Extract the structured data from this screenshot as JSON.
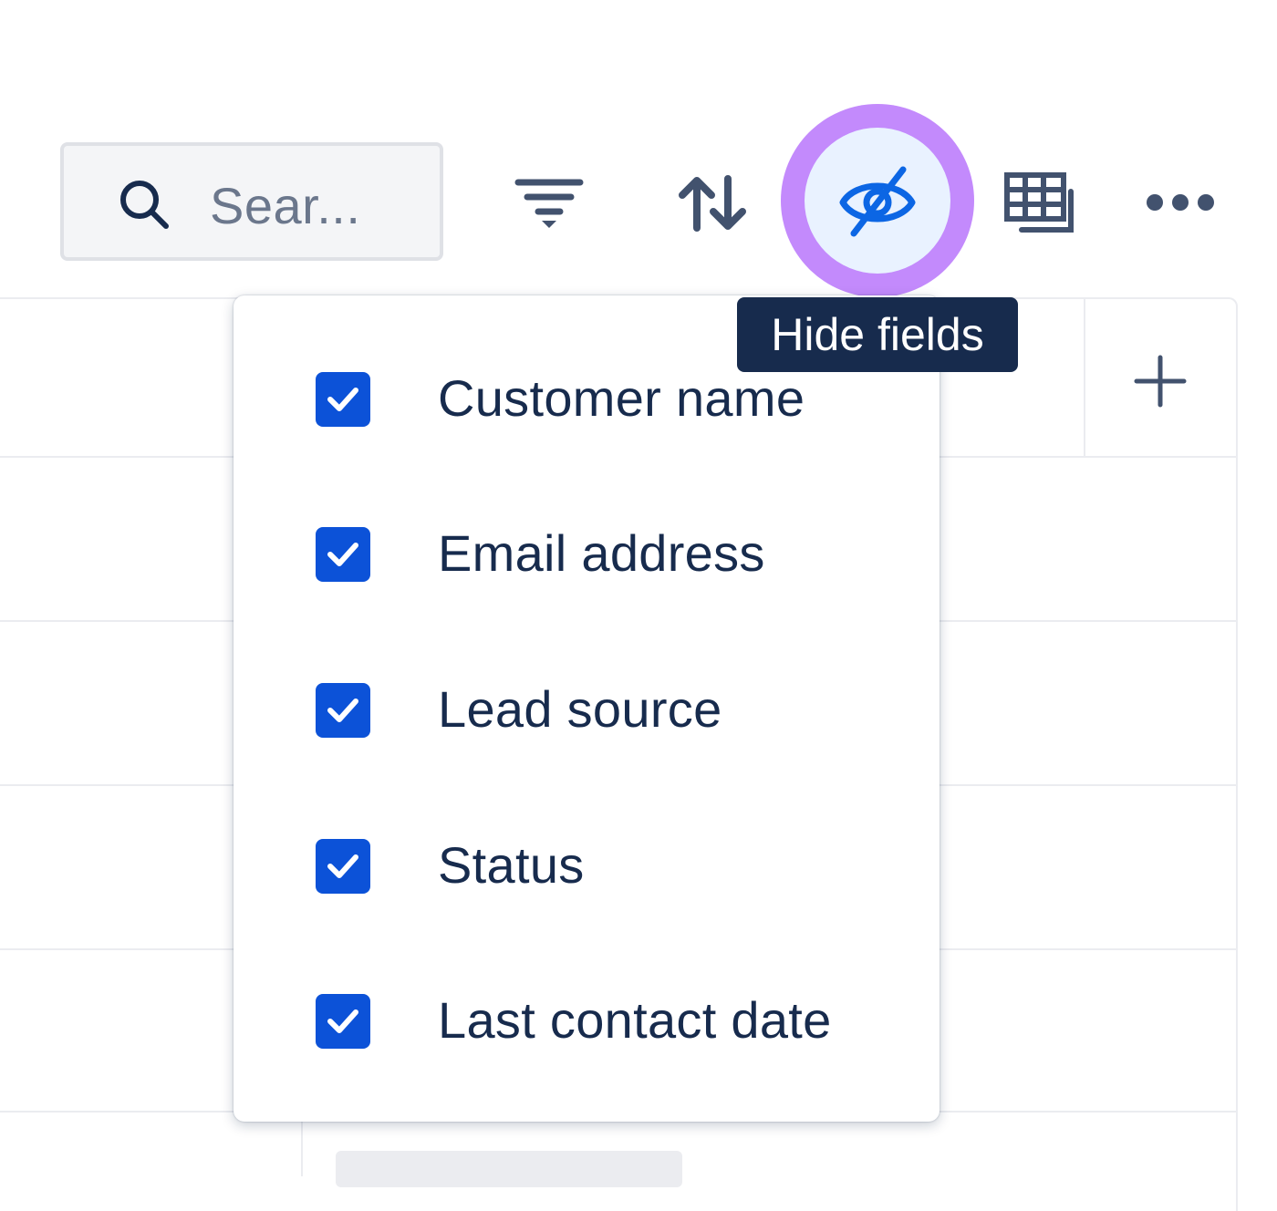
{
  "toolbar": {
    "search": {
      "placeholder": "Sear..."
    },
    "icons": [
      "search-icon",
      "filter-icon",
      "sort-icon",
      "eye-off-icon",
      "table-view-icon",
      "more-icon"
    ],
    "hide_fields_tooltip": "Hide fields"
  },
  "hide_fields_menu": {
    "items": [
      {
        "label": "Customer name",
        "checked": true
      },
      {
        "label": "Email address",
        "checked": true
      },
      {
        "label": "Lead source",
        "checked": true
      },
      {
        "label": "Status",
        "checked": true
      },
      {
        "label": "Last contact date",
        "checked": true
      }
    ]
  },
  "colors": {
    "accent": "#0c52d8",
    "highlight_ring": "#c084fc",
    "tooltip_bg": "#172b4d",
    "text": "#172b4d"
  }
}
